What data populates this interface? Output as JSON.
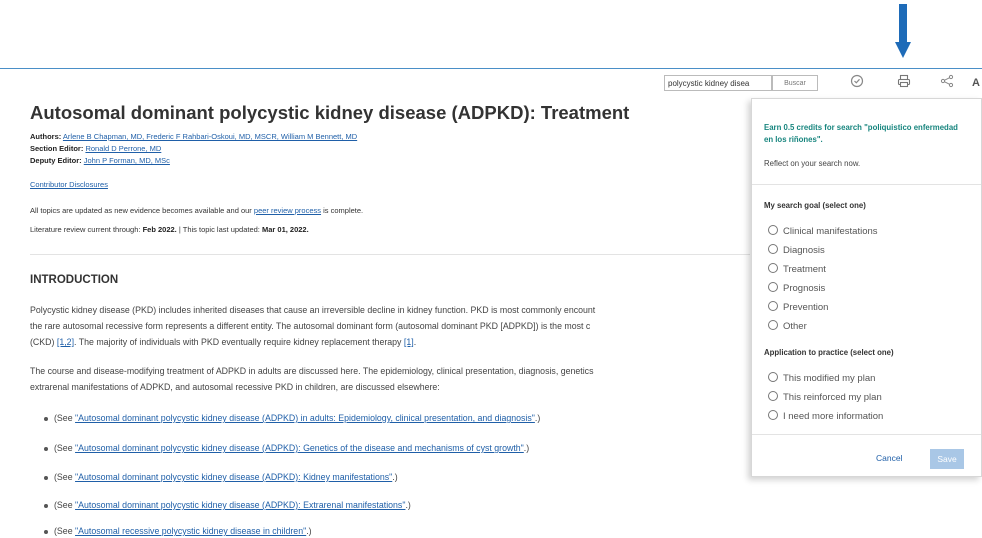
{
  "toolbar": {
    "search_value": "polycystic kidney disea",
    "search_button": "Buscar",
    "icons": [
      "check-circle-icon",
      "print-icon",
      "share-icon",
      "font-size-icon"
    ],
    "font_icon_glyph": "A"
  },
  "article": {
    "title": "Autosomal dominant polycystic kidney disease (ADPKD): Treatment",
    "authors_label": "Authors:",
    "authors": "Arlene B Chapman, MD, Frederic F Rahbari-Oskoui, MD, MSCR, William M Bennett, MD",
    "section_editor_label": "Section Editor:",
    "section_editor": "Ronald D Perrone, MD",
    "deputy_editor_label": "Deputy Editor:",
    "deputy_editor": "John P Forman, MD, MSc",
    "contributor_disclosures": "Contributor Disclosures",
    "update_text_pre": "All topics are updated as new evidence becomes available and our",
    "peer_review_link": "peer review process",
    "update_text_post": "is complete.",
    "review_label": "Literature review current through:",
    "review_date": "Feb 2022.",
    "updated_label": "| This topic last updated:",
    "updated_date": "Mar 01, 2022."
  },
  "intro": {
    "heading": "INTRODUCTION",
    "p1_line1": "Polycystic kidney disease (PKD) includes inherited diseases that cause an irreversible decline in kidney function. PKD is most commonly encount",
    "p1_line2": "the rare autosomal recessive form represents a different entity. The autosomal dominant form (autosomal dominant PKD [ADPKD]) is the most c",
    "p1_line3_a": "(CKD)",
    "p1_ref1": "[1,2]",
    "p1_line3_b": ". The majority of individuals with PKD eventually require kidney replacement therapy",
    "p1_ref2": "[1]",
    "p1_line3_c": ".",
    "p2_line1": "The course and disease-modifying treatment of ADPKD in adults are discussed here. The epidemiology, clinical presentation, diagnosis, genetics",
    "p2_line2": "extrarenal manifestations of ADPKD, and autosomal recessive PKD in children, are discussed elsewhere:",
    "see_prefix": "(See",
    "see_suffix": ".)",
    "links": [
      "\"Autosomal dominant polycystic kidney disease (ADPKD) in adults: Epidemiology, clinical presentation, and diagnosis\"",
      "\"Autosomal dominant polycystic kidney disease (ADPKD): Genetics of the disease and mechanisms of cyst growth\"",
      "\"Autosomal dominant polycystic kidney disease (ADPKD): Kidney manifestations\"",
      "\"Autosomal dominant polycystic kidney disease (ADPKD): Extrarenal manifestations\"",
      "\"Autosomal recessive polycystic kidney disease in children\""
    ]
  },
  "panel": {
    "earn_text": "Earn 0.5 credits for search \"poliquistico enfermedad en los riñones\".",
    "reflect_text": "Reflect on your search now.",
    "goal_heading": "My search goal (select one)",
    "goal_options": [
      "Clinical manifestations",
      "Diagnosis",
      "Treatment",
      "Prognosis",
      "Prevention",
      "Other"
    ],
    "practice_heading": "Application to practice (select one)",
    "practice_options": [
      "This modified my plan",
      "This reinforced my plan",
      "I need more information"
    ],
    "cancel_label": "Cancel",
    "save_label": "Save"
  },
  "colors": {
    "accent_blue": "#1f5fa8",
    "annotation_arrow": "#1e6bb8",
    "earn_teal": "#17857e",
    "save_disabled": "#a9c7e6"
  }
}
